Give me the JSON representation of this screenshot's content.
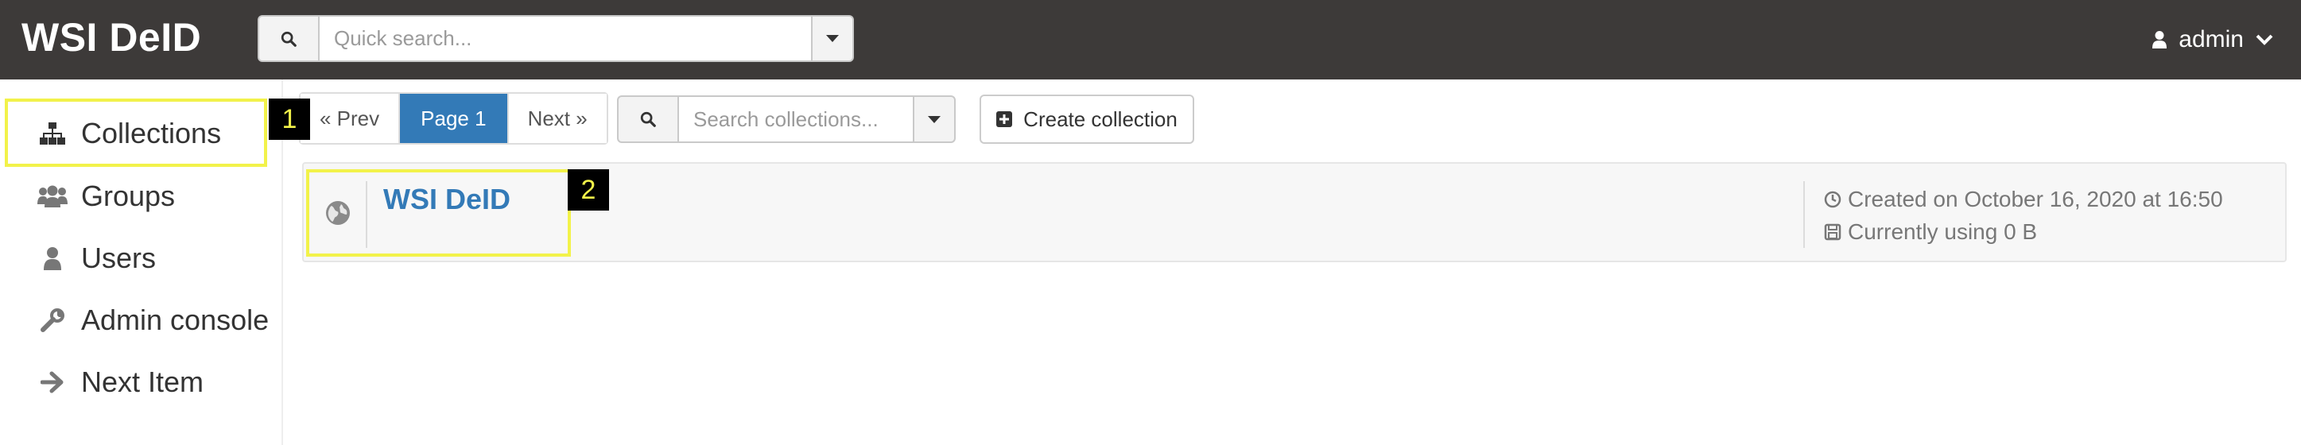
{
  "app": {
    "title": "WSI DeID"
  },
  "search": {
    "placeholder": "Quick search..."
  },
  "user": {
    "name": "admin"
  },
  "sidebar": {
    "items": [
      {
        "label": "Collections",
        "icon": "sitemap-icon",
        "active": true
      },
      {
        "label": "Groups",
        "icon": "users-icon"
      },
      {
        "label": "Users",
        "icon": "user-icon"
      },
      {
        "label": "Admin console",
        "icon": "wrench-icon"
      },
      {
        "label": "Next Item",
        "icon": "arrow-right-icon"
      }
    ]
  },
  "pager": {
    "prev": "« Prev",
    "current": "Page 1",
    "next": "Next »"
  },
  "collection_search": {
    "placeholder": "Search collections..."
  },
  "toolbar": {
    "create_label": "Create collection"
  },
  "collections": [
    {
      "name": "WSI DeID",
      "created": "Created on October 16, 2020 at 16:50",
      "usage": "Currently using 0 B"
    }
  ],
  "annotations": [
    {
      "label": "1",
      "target": "Collections"
    },
    {
      "label": "2",
      "target": "WSI DeID"
    }
  ],
  "colors": {
    "topbar": "#3d3a39",
    "accent": "#337ab7",
    "highlight": "#f2f24a"
  }
}
